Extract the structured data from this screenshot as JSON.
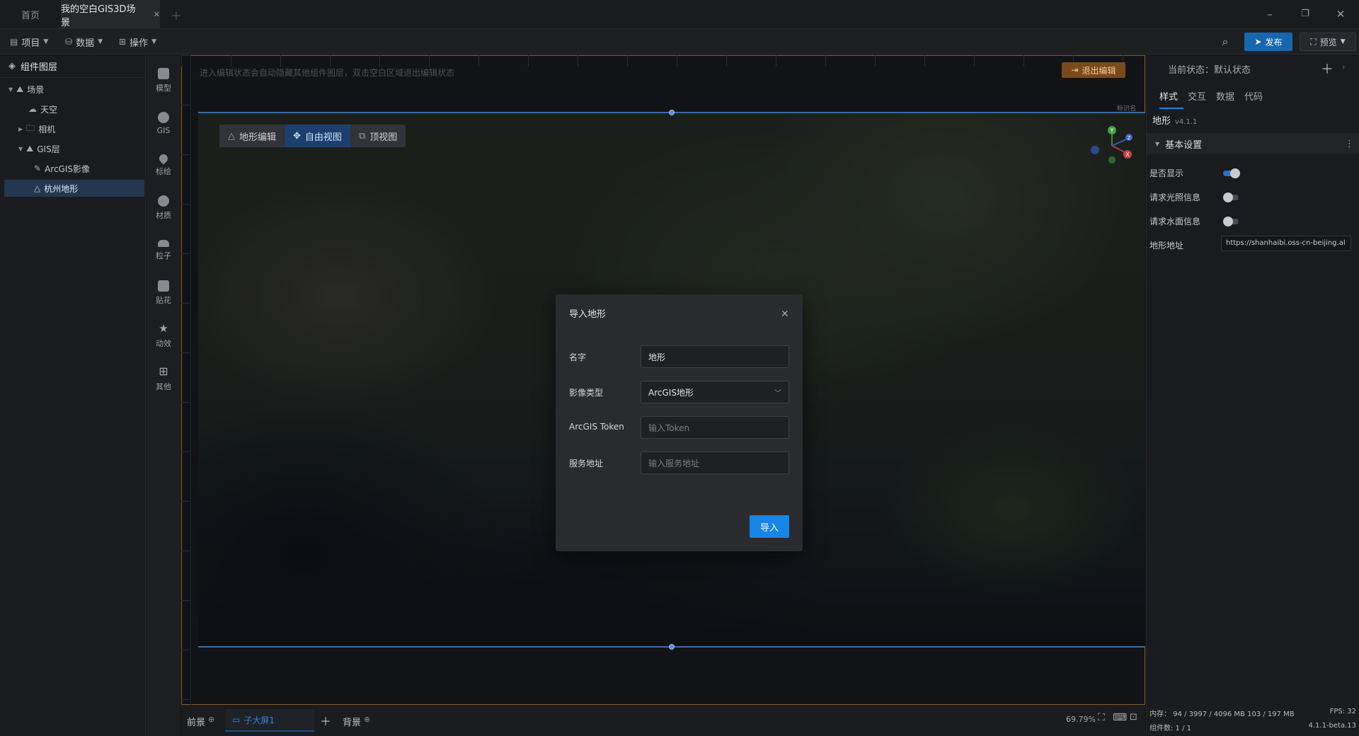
{
  "tabs": [
    {
      "label": "首页"
    },
    {
      "label": "我的空白GIS3D场景"
    }
  ],
  "window_controls": {
    "minimize": "–",
    "restore": "❐",
    "close": "✕"
  },
  "menubar": {
    "project": "项目",
    "data": "数据",
    "operate": "操作",
    "publish": "发布",
    "preview": "预览"
  },
  "layer_panel": {
    "title": "组件图层",
    "tree": [
      {
        "label": "场景",
        "icon": "scene-icon"
      },
      {
        "label": "天空",
        "icon": "sky-icon"
      },
      {
        "label": "相机",
        "icon": "folder-icon"
      },
      {
        "label": "GIS层",
        "icon": "gis-layer-icon"
      },
      {
        "label": "ArcGIS影像",
        "icon": "imagery-icon"
      },
      {
        "label": "杭州地形",
        "icon": "terrain-icon"
      }
    ]
  },
  "tool_rail": [
    {
      "label": "模型"
    },
    {
      "label": "GIS"
    },
    {
      "label": "标绘"
    },
    {
      "label": "材质"
    },
    {
      "label": "粒子"
    },
    {
      "label": "贴花"
    },
    {
      "label": "动效"
    },
    {
      "label": "其他"
    }
  ],
  "canvas": {
    "hint": "进入编辑状态会自动隐藏其他组件图层，双击空白区域退出编辑状态",
    "exit_edit": "退出编辑",
    "view_toolbar": {
      "terrain_edit": "地形编辑",
      "free_view": "自由视图",
      "top_view": "顶视图"
    },
    "tag": "标识名"
  },
  "dialog": {
    "title": "导入地形",
    "name_label": "名字",
    "name_value": "地形",
    "type_label": "影像类型",
    "type_value": "ArcGIS地形",
    "token_label": "ArcGIS Token",
    "token_placeholder": "输入Token",
    "url_label": "服务地址",
    "url_placeholder": "输入服务地址",
    "import_button": "导入"
  },
  "bottom": {
    "front": "前景",
    "sub_screen": "子大屏1",
    "background": "背景",
    "zoom": "69.79%"
  },
  "right_panel": {
    "state_label": "当前状态：默认状态",
    "tabs": [
      "样式",
      "交互",
      "数据",
      "代码"
    ],
    "component": "地形",
    "version": "v4.1.1",
    "section": "基本设置",
    "rows": [
      {
        "label": "是否显示",
        "on": true
      },
      {
        "label": "请求光照信息",
        "on": false
      },
      {
        "label": "请求水面信息",
        "on": false
      }
    ],
    "terrain_url_label": "地形地址",
    "terrain_url_value": "https://shanhaibi.oss-cn-beijing.al"
  },
  "status": {
    "memory": "内存： 94 / 3997 / 4096 MB  103 / 197 MB",
    "fps": "FPS:  32",
    "components": "组件数: 1 / 1",
    "build": "4.1.1-beta.13"
  },
  "colors": {
    "accent": "#1785e8",
    "publish": "#1767b0",
    "exit": "#7b4a1a",
    "frame": "#8a5a2a"
  }
}
